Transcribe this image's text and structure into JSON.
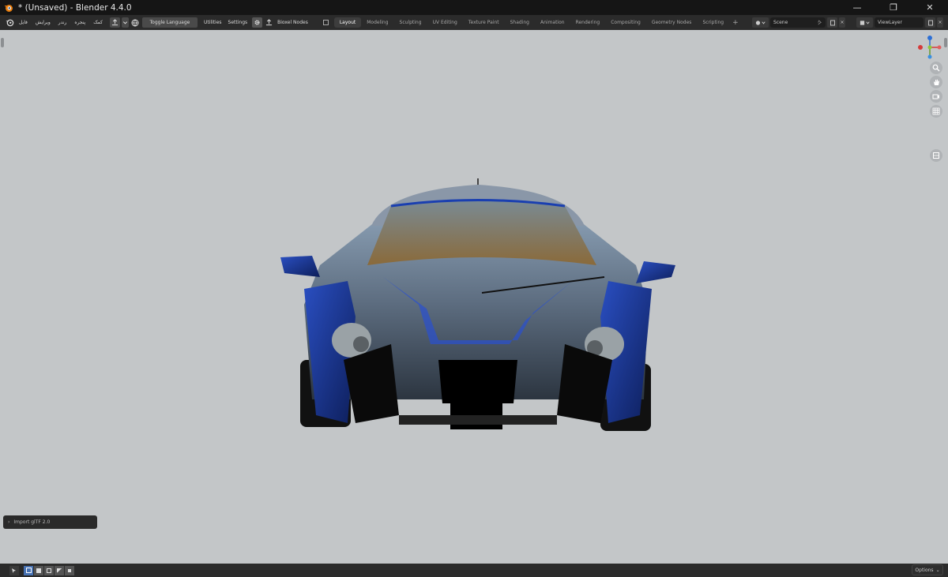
{
  "window": {
    "title": "* (Unsaved) - Blender 4.4.0"
  },
  "menu": {
    "items": [
      "فایل",
      "ویرایش",
      "رندر",
      "پنجره",
      "کمک"
    ]
  },
  "toolbar": {
    "toggle_language": "Toggle Language",
    "utilities": "Utilities",
    "settings": "Settings",
    "bioxel_nodes": "Bioxel Nodes"
  },
  "workspaces": [
    "Layout",
    "Modeling",
    "Sculpting",
    "UV Editing",
    "Texture Paint",
    "Shading",
    "Animation",
    "Rendering",
    "Compositing",
    "Geometry Nodes",
    "Scripting"
  ],
  "scene": {
    "name": "Scene"
  },
  "view_layer": {
    "name": "ViewLayer"
  },
  "operator_panel": {
    "label": "Import glTF 2.0"
  },
  "status": {
    "options_label": "Options"
  },
  "colors": {
    "accent": "#4772b3",
    "viewport_bg": "#c3c6c8",
    "header_bg": "#2b2b2b"
  }
}
